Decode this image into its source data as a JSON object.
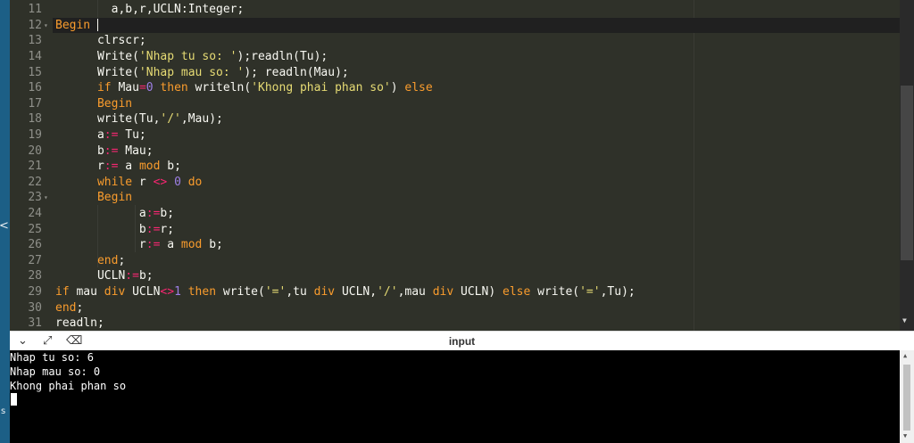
{
  "editor": {
    "lines": [
      {
        "n": "11",
        "fold": "",
        "tokens": [
          [
            "pl",
            "        a,b,r,UCLN:Integer;"
          ]
        ]
      },
      {
        "n": "12",
        "fold": "▾",
        "tokens": [
          [
            "kw",
            "Begin"
          ]
        ],
        "active": true
      },
      {
        "n": "13",
        "fold": "",
        "tokens": [
          [
            "pl",
            "      clrscr;"
          ]
        ]
      },
      {
        "n": "14",
        "fold": "",
        "tokens": [
          [
            "pl",
            "      Write("
          ],
          [
            "str",
            "'Nhap tu so: '"
          ],
          [
            "pl",
            ");readln(Tu);"
          ]
        ]
      },
      {
        "n": "15",
        "fold": "",
        "tokens": [
          [
            "pl",
            "      Write("
          ],
          [
            "str",
            "'Nhap mau so: '"
          ],
          [
            "pl",
            "); readln(Mau);"
          ]
        ]
      },
      {
        "n": "16",
        "fold": "",
        "tokens": [
          [
            "pl",
            "      "
          ],
          [
            "kw",
            "if"
          ],
          [
            "pl",
            " Mau"
          ],
          [
            "op",
            "="
          ],
          [
            "num",
            "0"
          ],
          [
            "pl",
            " "
          ],
          [
            "kw",
            "then"
          ],
          [
            "pl",
            " writeln("
          ],
          [
            "str",
            "'Khong phai phan so'"
          ],
          [
            "pl",
            ") "
          ],
          [
            "kw",
            "else"
          ]
        ]
      },
      {
        "n": "17",
        "fold": "",
        "tokens": [
          [
            "pl",
            "      "
          ],
          [
            "kw",
            "Begin"
          ]
        ]
      },
      {
        "n": "18",
        "fold": "",
        "tokens": [
          [
            "pl",
            "      write(Tu,"
          ],
          [
            "str",
            "'/'"
          ],
          [
            "pl",
            ",Mau);"
          ]
        ]
      },
      {
        "n": "19",
        "fold": "",
        "tokens": [
          [
            "pl",
            "      a"
          ],
          [
            "op",
            ":="
          ],
          [
            "pl",
            " Tu;"
          ]
        ]
      },
      {
        "n": "20",
        "fold": "",
        "tokens": [
          [
            "pl",
            "      b"
          ],
          [
            "op",
            ":="
          ],
          [
            "pl",
            " Mau;"
          ]
        ]
      },
      {
        "n": "21",
        "fold": "",
        "tokens": [
          [
            "pl",
            "      r"
          ],
          [
            "op",
            ":="
          ],
          [
            "pl",
            " a "
          ],
          [
            "kw",
            "mod"
          ],
          [
            "pl",
            " b;"
          ]
        ]
      },
      {
        "n": "22",
        "fold": "",
        "tokens": [
          [
            "pl",
            "      "
          ],
          [
            "kw",
            "while"
          ],
          [
            "pl",
            " r "
          ],
          [
            "op",
            "<>"
          ],
          [
            "pl",
            " "
          ],
          [
            "num",
            "0"
          ],
          [
            "pl",
            " "
          ],
          [
            "kw",
            "do"
          ]
        ]
      },
      {
        "n": "23",
        "fold": "▾",
        "tokens": [
          [
            "pl",
            "      "
          ],
          [
            "kw",
            "Begin"
          ]
        ]
      },
      {
        "n": "24",
        "fold": "",
        "tokens": [
          [
            "pl",
            "            a"
          ],
          [
            "op",
            ":="
          ],
          [
            "pl",
            "b;"
          ]
        ]
      },
      {
        "n": "25",
        "fold": "",
        "tokens": [
          [
            "pl",
            "            b"
          ],
          [
            "op",
            ":="
          ],
          [
            "pl",
            "r;"
          ]
        ]
      },
      {
        "n": "26",
        "fold": "",
        "tokens": [
          [
            "pl",
            "            r"
          ],
          [
            "op",
            ":="
          ],
          [
            "pl",
            " a "
          ],
          [
            "kw",
            "mod"
          ],
          [
            "pl",
            " b;"
          ]
        ]
      },
      {
        "n": "27",
        "fold": "",
        "tokens": [
          [
            "pl",
            "      "
          ],
          [
            "kw",
            "end"
          ],
          [
            "pl",
            ";"
          ]
        ]
      },
      {
        "n": "28",
        "fold": "",
        "tokens": [
          [
            "pl",
            "      UCLN"
          ],
          [
            "op",
            ":="
          ],
          [
            "pl",
            "b;"
          ]
        ]
      },
      {
        "n": "29",
        "fold": "",
        "tokens": [
          [
            "kw",
            "if"
          ],
          [
            "pl",
            " mau "
          ],
          [
            "kw",
            "div"
          ],
          [
            "pl",
            " UCLN"
          ],
          [
            "op",
            "<>"
          ],
          [
            "num",
            "1"
          ],
          [
            "pl",
            " "
          ],
          [
            "kw",
            "then"
          ],
          [
            "pl",
            " write("
          ],
          [
            "str",
            "'='"
          ],
          [
            "pl",
            ",tu "
          ],
          [
            "kw",
            "div"
          ],
          [
            "pl",
            " UCLN,"
          ],
          [
            "str",
            "'/'"
          ],
          [
            "pl",
            ",mau "
          ],
          [
            "kw",
            "div"
          ],
          [
            "pl",
            " UCLN) "
          ],
          [
            "kw",
            "else"
          ],
          [
            "pl",
            " write("
          ],
          [
            "str",
            "'='"
          ],
          [
            "pl",
            ",Tu);"
          ]
        ]
      },
      {
        "n": "30",
        "fold": "",
        "tokens": [
          [
            "kw",
            "end"
          ],
          [
            "pl",
            ";"
          ]
        ]
      },
      {
        "n": "31",
        "fold": "",
        "tokens": [
          [
            "pl",
            "readln;"
          ]
        ]
      }
    ]
  },
  "panel": {
    "title": "input",
    "icons": [
      "chevron-down-icon",
      "expand-icon",
      "clear-icon"
    ]
  },
  "console": {
    "lines": [
      "Nhap tu so: 6",
      "Nhap mau so: 0",
      "Khong phai phan so"
    ]
  },
  "left_strip": {
    "chevron": "<",
    "label": "s"
  },
  "colors": {
    "keyword": "#f99c2d",
    "string": "#e6db74",
    "number": "#9d7fe5",
    "operator": "#f92672",
    "text": "#f8f8f2",
    "background": "#2f3129"
  }
}
